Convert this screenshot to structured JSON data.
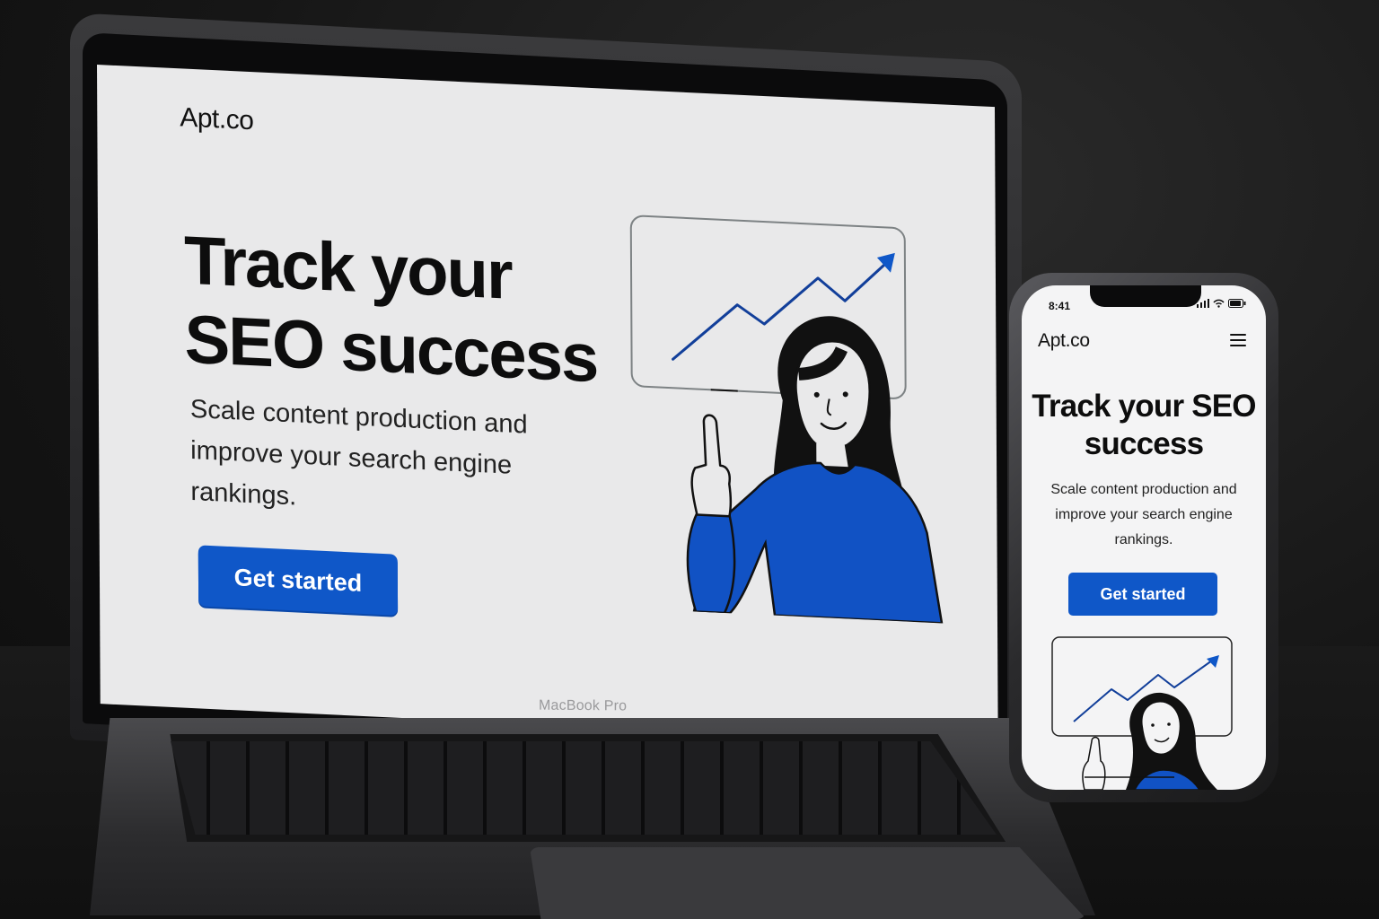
{
  "device_label": "MacBook Pro",
  "laptop_page": {
    "logo": "Apt.co",
    "headline": "Track your SEO success",
    "subtitle": "Scale content production and improve your search engine rankings.",
    "cta": "Get started"
  },
  "phone_page": {
    "time": "8:41",
    "logo": "Apt.co",
    "headline": "Track your SEO success",
    "subtitle": "Scale content production and improve your search engine rankings.",
    "cta": "Get started"
  },
  "colors": {
    "accent": "#0f57c8",
    "page_bg": "#e9e9ea",
    "text": "#0d0d0d"
  },
  "icons": [
    "hamburger-menu-icon",
    "signal-icon",
    "wifi-icon",
    "battery-icon",
    "trend-arrow-icon"
  ]
}
